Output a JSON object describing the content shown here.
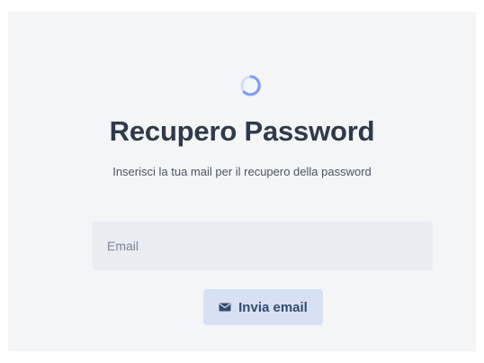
{
  "page": {
    "title": "Recupero Password",
    "subtitle": "Inserisci la tua mail per il recupero della password",
    "logo_icon": "loading-ring-icon",
    "accent_color": "#7f9cf5"
  },
  "form": {
    "email": {
      "placeholder": "Email",
      "value": ""
    },
    "submit": {
      "label": "Invia email",
      "icon": "envelope-icon"
    }
  }
}
